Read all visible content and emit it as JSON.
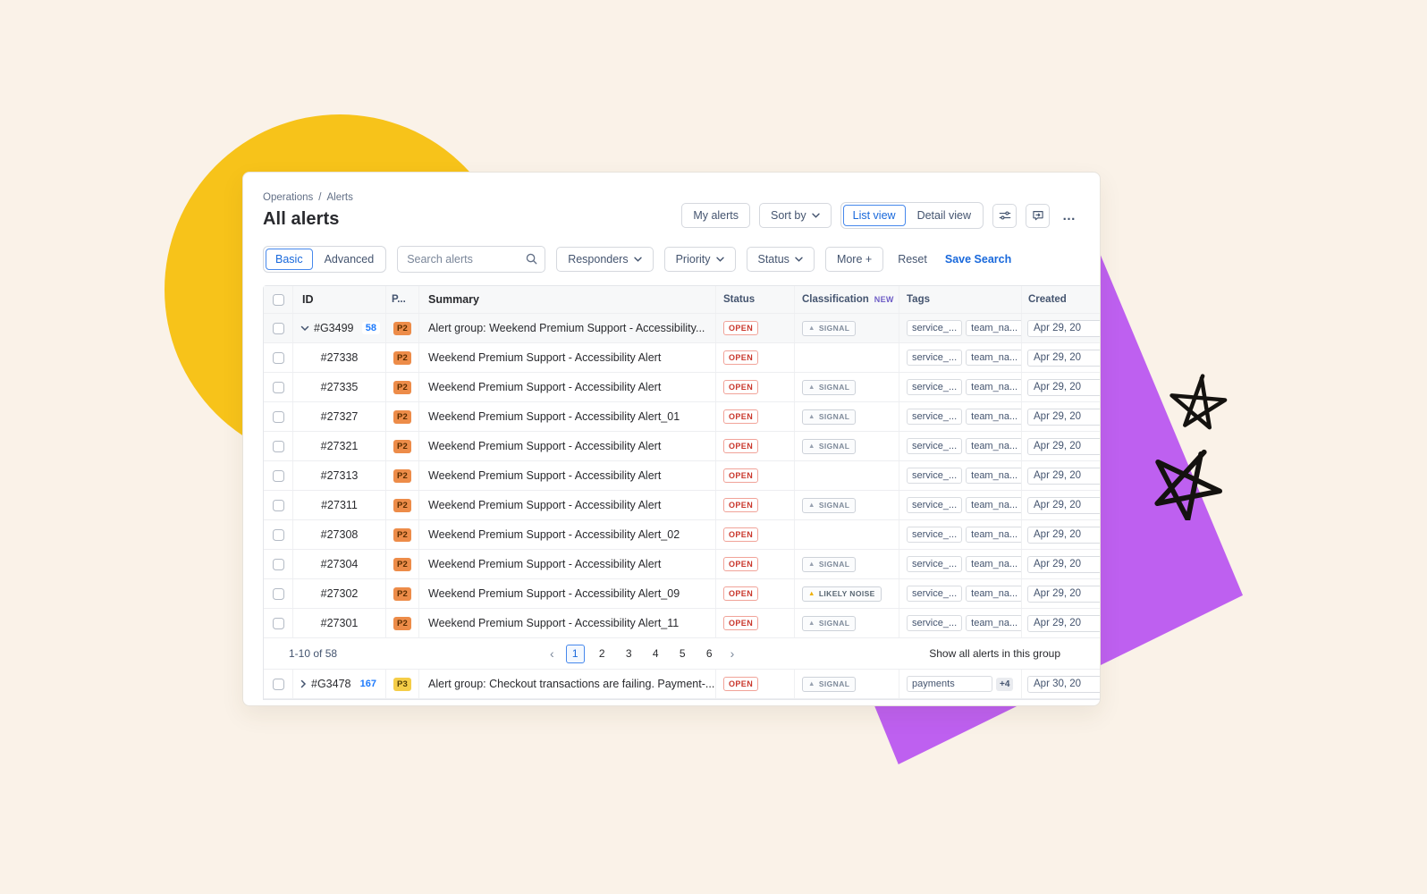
{
  "window": {
    "breadcrumb": {
      "level1": "Operations",
      "separator": "/",
      "level2": "Alerts"
    },
    "title": "All alerts",
    "toolbar": {
      "my_alerts": "My alerts",
      "sort_by": "Sort by",
      "list_view": "List view",
      "detail_view": "Detail view",
      "more": "…"
    },
    "filters": {
      "basic": "Basic",
      "advanced": "Advanced",
      "search_placeholder": "Search alerts",
      "responders": "Responders",
      "priority": "Priority",
      "status": "Status",
      "more": "More +",
      "reset": "Reset",
      "save_search": "Save Search"
    },
    "table": {
      "headers": {
        "id": "ID",
        "priority": "P...",
        "summary": "Summary",
        "status": "Status",
        "classification": "Classification",
        "classification_badge": "NEW",
        "tags": "Tags",
        "created": "Created"
      },
      "group_row": {
        "id": "#G3499",
        "count": "58",
        "priority": "P2",
        "summary": "Alert group: Weekend Premium Support - Accessibility...",
        "status": "OPEN",
        "classification": "signal",
        "tags": [
          "service_...",
          "team_na..."
        ],
        "created": "Apr 29, 20"
      },
      "rows": [
        {
          "id": "#27338",
          "priority": "P2",
          "summary": "Weekend Premium Support - Accessibility Alert",
          "status": "OPEN",
          "classification": "",
          "tags": [
            "service_...",
            "team_na..."
          ],
          "created": "Apr 29, 20"
        },
        {
          "id": "#27335",
          "priority": "P2",
          "summary": "Weekend Premium Support - Accessibility Alert",
          "status": "OPEN",
          "classification": "signal",
          "tags": [
            "service_...",
            "team_na..."
          ],
          "created": "Apr 29, 20"
        },
        {
          "id": "#27327",
          "priority": "P2",
          "summary": "Weekend Premium Support - Accessibility Alert_01",
          "status": "OPEN",
          "classification": "signal",
          "tags": [
            "service_...",
            "team_na..."
          ],
          "created": "Apr 29, 20"
        },
        {
          "id": "#27321",
          "priority": "P2",
          "summary": "Weekend Premium Support - Accessibility Alert",
          "status": "OPEN",
          "classification": "signal",
          "tags": [
            "service_...",
            "team_na..."
          ],
          "created": "Apr 29, 20"
        },
        {
          "id": "#27313",
          "priority": "P2",
          "summary": "Weekend Premium Support - Accessibility Alert",
          "status": "OPEN",
          "classification": "",
          "tags": [
            "service_...",
            "team_na..."
          ],
          "created": "Apr 29, 20"
        },
        {
          "id": "#27311",
          "priority": "P2",
          "summary": "Weekend Premium Support - Accessibility Alert",
          "status": "OPEN",
          "classification": "signal",
          "tags": [
            "service_...",
            "team_na..."
          ],
          "created": "Apr 29, 20"
        },
        {
          "id": "#27308",
          "priority": "P2",
          "summary": "Weekend Premium Support - Accessibility Alert_02",
          "status": "OPEN",
          "classification": "",
          "tags": [
            "service_...",
            "team_na..."
          ],
          "created": "Apr 29, 20"
        },
        {
          "id": "#27304",
          "priority": "P2",
          "summary": "Weekend Premium Support - Accessibility Alert",
          "status": "OPEN",
          "classification": "signal",
          "tags": [
            "service_...",
            "team_na..."
          ],
          "created": "Apr 29, 20"
        },
        {
          "id": "#27302",
          "priority": "P2",
          "summary": "Weekend Premium Support - Accessibility Alert_09",
          "status": "OPEN",
          "classification": "noise",
          "tags": [
            "service_...",
            "team_na..."
          ],
          "created": "Apr 29, 20"
        },
        {
          "id": "#27301",
          "priority": "P2",
          "summary": "Weekend Premium Support - Accessibility Alert_11",
          "status": "OPEN",
          "classification": "signal",
          "tags": [
            "service_...",
            "team_na..."
          ],
          "created": "Apr 29, 20"
        }
      ],
      "pagination": {
        "range": "1-10 of 58",
        "prev": "‹",
        "next": "›",
        "pages": [
          "1",
          "2",
          "3",
          "4",
          "5",
          "6"
        ],
        "current": "1",
        "show_all": "Show all alerts in this group"
      },
      "bottom_group_row": {
        "id": "#G3478",
        "count": "167",
        "priority": "P3",
        "summary": "Alert group: Checkout transactions are failing. Payment-...",
        "status": "OPEN",
        "classification": "signal",
        "tags": [
          "payments"
        ],
        "tags_more": "+4",
        "created": "Apr 30, 20"
      }
    }
  },
  "badges": {
    "signal": "SIGNAL",
    "noise": "LIKELY NOISE",
    "triangle": "▲"
  },
  "colors": {
    "accent_blue": "#1868DB",
    "brand_yellow": "#F7C31A",
    "brand_purple": "#BE60F0",
    "status_red": "#C9372C",
    "priority_p2": "#ED8C49",
    "priority_p3": "#F5CD47",
    "new_purple": "#6E5DC6"
  }
}
